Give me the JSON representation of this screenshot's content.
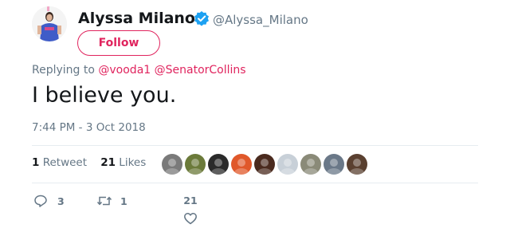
{
  "tweet": {
    "author": {
      "display_name": "Alyssa Milano",
      "handle": "@Alyssa_Milano",
      "verified": true,
      "avatar_icon": "profile-photo"
    },
    "follow_label": "Follow",
    "replying_to_label": "Replying to",
    "replying_to": [
      "@vooda1",
      "@SenatorCollins"
    ],
    "text": "I believe you.",
    "timestamp": "7:44 PM - 3 Oct 2018"
  },
  "stats": {
    "retweets_count": "1",
    "retweets_label": "Retweet",
    "likes_count": "21",
    "likes_label": "Likes"
  },
  "likers": [
    {
      "icon": "liker-avatar-1",
      "color": "#7a7a7a"
    },
    {
      "icon": "liker-avatar-2",
      "color": "#6b7a3a"
    },
    {
      "icon": "liker-avatar-3",
      "color": "#2a2a2a"
    },
    {
      "icon": "liker-avatar-4",
      "color": "#e0582a"
    },
    {
      "icon": "liker-avatar-5",
      "color": "#4a2a1e"
    },
    {
      "icon": "liker-avatar-6",
      "color": "#c8d0d8"
    },
    {
      "icon": "liker-avatar-7",
      "color": "#8a8a78"
    },
    {
      "icon": "liker-avatar-8",
      "color": "#6a7888"
    },
    {
      "icon": "liker-avatar-9",
      "color": "#5a4030"
    }
  ],
  "actions": {
    "reply_count": "3",
    "retweet_count": "1",
    "like_count": "21"
  },
  "colors": {
    "accent": "#e0245e",
    "verified": "#1da1f2",
    "muted": "#657786"
  }
}
